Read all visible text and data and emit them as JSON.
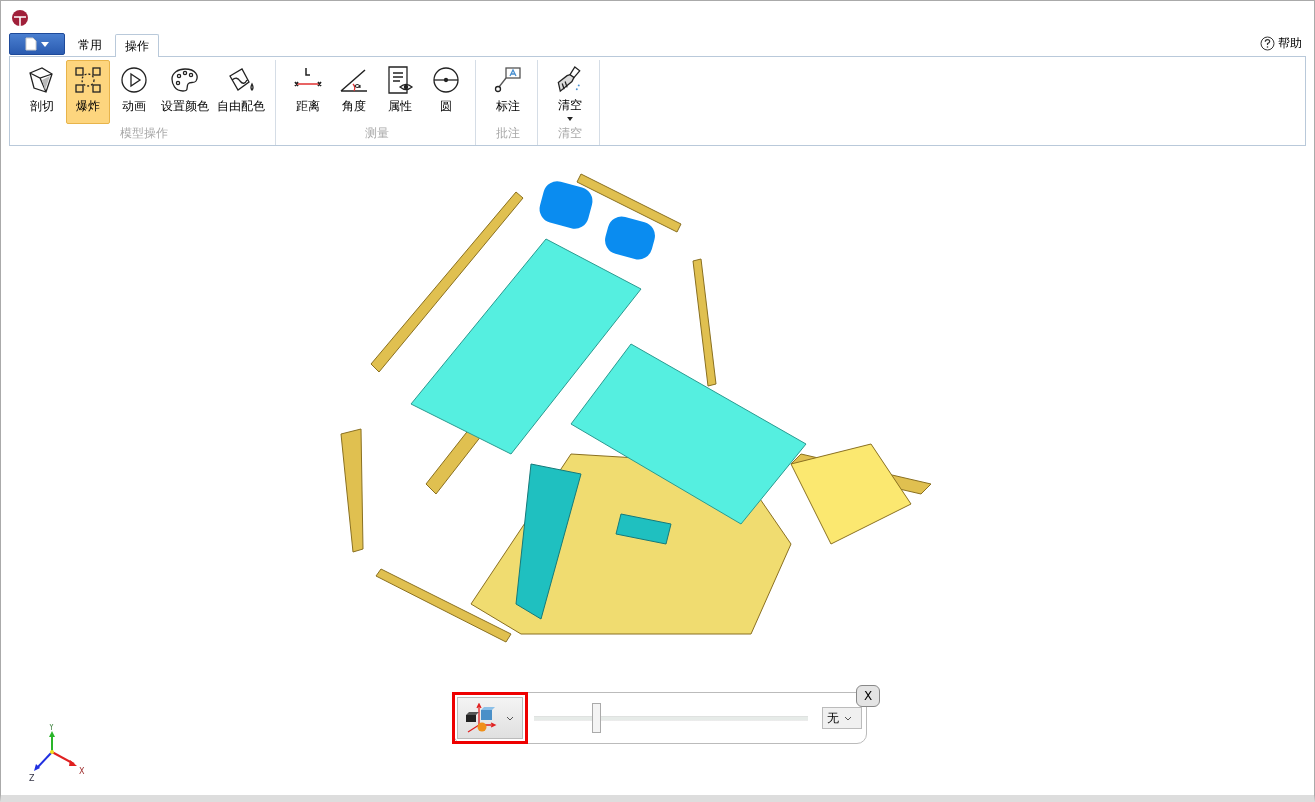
{
  "tabs": [
    {
      "label": "常用",
      "selected": false
    },
    {
      "label": "操作",
      "selected": true
    }
  ],
  "help": {
    "label": "帮助"
  },
  "ribbon_groups": [
    {
      "label": "模型操作",
      "tools": [
        {
          "label": "剖切",
          "selected": false,
          "dropdown": false
        },
        {
          "label": "爆炸",
          "selected": true,
          "dropdown": false
        },
        {
          "label": "动画",
          "selected": false,
          "dropdown": false
        },
        {
          "label": "设置颜色",
          "selected": false,
          "dropdown": false
        },
        {
          "label": "自由配色",
          "selected": false,
          "dropdown": false
        }
      ]
    },
    {
      "label": "测量",
      "tools": [
        {
          "label": "距离",
          "selected": false,
          "dropdown": false
        },
        {
          "label": "角度",
          "selected": false,
          "dropdown": false
        },
        {
          "label": "属性",
          "selected": false,
          "dropdown": false
        },
        {
          "label": "圆",
          "selected": false,
          "dropdown": false
        }
      ]
    },
    {
      "label": "批注",
      "tools": [
        {
          "label": "标注",
          "selected": false,
          "dropdown": false
        }
      ]
    },
    {
      "label": "清空",
      "tools": [
        {
          "label": "清空",
          "selected": false,
          "dropdown": true
        }
      ]
    }
  ],
  "viewport": {
    "kind": "picture"
  },
  "axis_labels": [
    "Y",
    "Z",
    "X"
  ],
  "explode_panel": {
    "mode_button": {
      "highlighted": true
    },
    "slider": {
      "level": 0.23
    },
    "select": {
      "value": "无"
    },
    "close": "X"
  }
}
